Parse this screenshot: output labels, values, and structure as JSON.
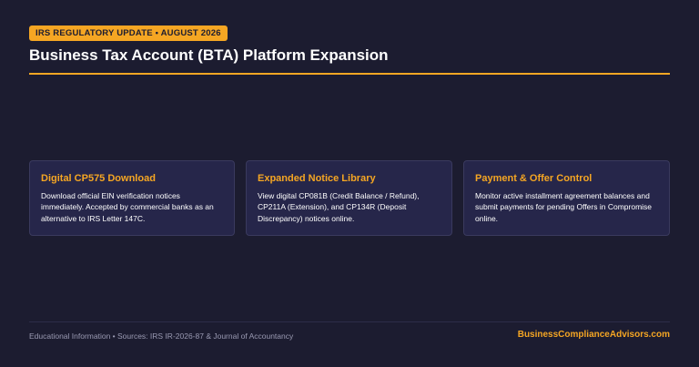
{
  "header": {
    "badge": "IRS REGULATORY UPDATE • AUGUST 2026",
    "title": "Business Tax Account (BTA) Platform Expansion"
  },
  "cards": [
    {
      "title": "Digital CP575 Download",
      "body": "Download official EIN verification notices immediately. Accepted by commercial banks as an alternative to IRS Letter 147C."
    },
    {
      "title": "Expanded Notice Library",
      "body": "View digital CP081B (Credit Balance / Refund), CP211A (Extension), and CP134R (Deposit Discrepancy) notices online."
    },
    {
      "title": "Payment & Offer Control",
      "body": "Monitor active installment agreement balances and submit payments for pending Offers in Compromise online."
    }
  ],
  "footer": {
    "sources": "Educational Information • Sources: IRS IR-2026-87 & Journal of Accountancy",
    "brand": "BusinessComplianceAdvisors.com"
  },
  "colors": {
    "background": "#1c1c30",
    "accent": "#f5a623",
    "card": "#26264a"
  }
}
